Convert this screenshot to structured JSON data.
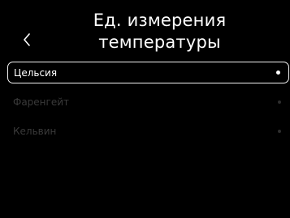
{
  "header": {
    "title": "Ед. измерения температуры",
    "back_icon": "chevron-left-icon"
  },
  "options": [
    {
      "label": "Цельсия",
      "selected": true
    },
    {
      "label": "Фаренгейт",
      "selected": false
    },
    {
      "label": "Кельвин",
      "selected": false
    }
  ],
  "colors": {
    "background": "#000000",
    "text": "#ffffff",
    "dim_text": "#3a3a3a",
    "selection_border": "#f2f2f2"
  }
}
